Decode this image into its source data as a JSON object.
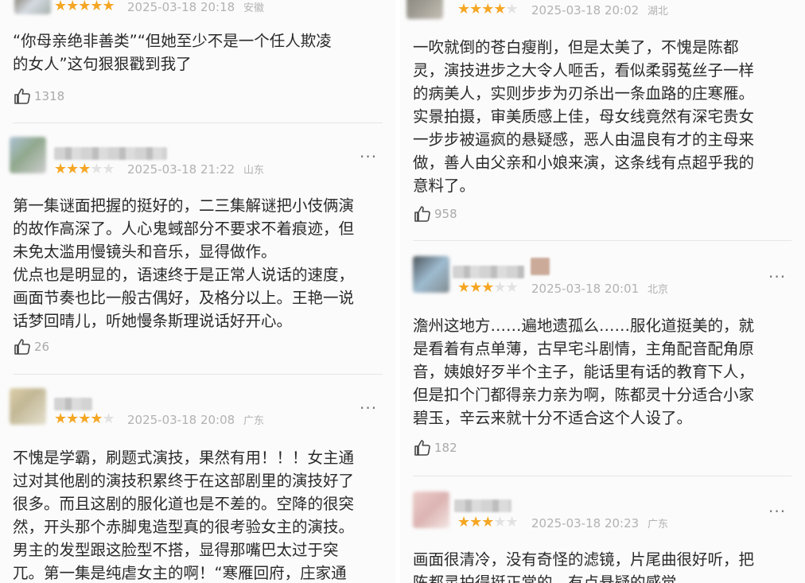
{
  "colors": {
    "star": "#f5a623",
    "star_off": "#e2e2e2",
    "meta": "#b2b2b2",
    "text": "#2a2a2a"
  },
  "left": [
    {
      "rating": 5,
      "date": "2025-03-18",
      "time": "20:18",
      "location": "安徽",
      "text": "“你母亲绝非善类”“但她至少不是一个任人欺凌\n的女人”这句狠狠戳到我了",
      "likes": "1318"
    },
    {
      "rating": 3,
      "date": "2025-03-18",
      "time": "21:22",
      "location": "山东",
      "text": "第一集谜面把握的挺好的，二三集解谜把小伎俩演\n的故作高深了。人心鬼蜮部分不要求不着痕迹，但\n未免太滥用慢镜头和音乐，显得做作。\n优点也是明显的，语速终于是正常人说话的速度，\n画面节奏也比一般古偶好，及格分以上。王艳一说\n话梦回晴儿，听她慢条斯理说话好开心。",
      "likes": "26"
    },
    {
      "rating": 4,
      "date": "2025-03-18",
      "time": "20:08",
      "location": "广东",
      "text": "不愧是学霸，刷题式演技，果然有用！！！女主通\n过对其他剧的演技积累终于在这部剧里的演技好了\n很多。而且这剧的服化道也是不差的。空降的很突\n然，开头那个赤脚鬼造型真的很考验女主的演技。\n男主的发型跟这脸型不搭，显得那嘴巴太过于突\n兀。第一集是纯虐女主的啊！“寒雁回府，庄家通\n晓”",
      "likes": ""
    }
  ],
  "right": [
    {
      "rating": 4,
      "date": "2025-03-18",
      "time": "20:02",
      "location": "湖北",
      "text": "一吹就倒的苍白瘦削，但是太美了，不愧是陈都\n灵，演技进步之大令人咂舌，看似柔弱菟丝子一样\n的病美人，实则步步为刃杀出一条血路的庄寒雁。\n实景拍摄，审美质感上佳，母女线竟然有深宅贵女\n一步步被逼疯的悬疑感，恶人由温良有才的主母来\n做，善人由父亲和小娘来演，这条线有点超乎我的\n意料了。",
      "likes": "958"
    },
    {
      "rating": 3,
      "date": "2025-03-18",
      "time": "20:01",
      "location": "北京",
      "text": "澹州这地方……遍地遗孤么……服化道挺美的，就\n是看着有点单薄，古早宅斗剧情，主角配音配角原\n音，姨娘好歹半个主子，能话里有话的教育下人，\n但是扣个门都得亲力亲为啊，陈都灵十分适合小家\n碧玉，辛云来就十分不适合这个人设了。",
      "likes": "182"
    },
    {
      "rating": 3,
      "date": "2025-03-18",
      "time": "20:23",
      "location": "广东",
      "text": "画面很清冷，没有奇怪的滤镜，片尾曲很好听，把\n陈都灵拍得挺正常的，有点悬疑的感觉",
      "likes": ""
    }
  ],
  "more_icon": "more-dots-icon",
  "like_icon": "thumbs-up-icon"
}
